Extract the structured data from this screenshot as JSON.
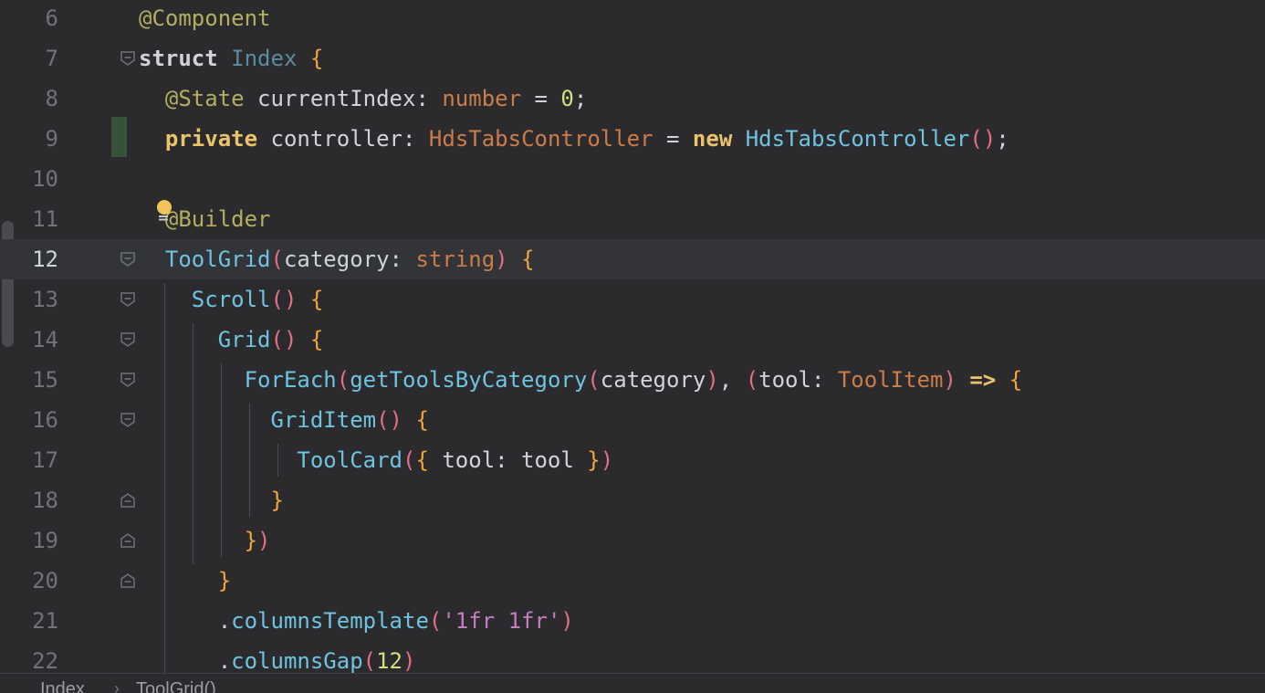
{
  "editor": {
    "lines": [
      {
        "number": "6",
        "tokens": [
          {
            "t": "@Component",
            "c": "ann"
          }
        ]
      },
      {
        "number": "7",
        "tokens": [
          {
            "t": "struct ",
            "c": "kw"
          },
          {
            "t": "Index",
            "c": "cls"
          },
          {
            "t": " ",
            "c": "pl"
          },
          {
            "t": "{",
            "c": "br1"
          }
        ]
      },
      {
        "number": "8",
        "tokens": [
          {
            "t": "  ",
            "c": "pl"
          },
          {
            "t": "@State",
            "c": "ann"
          },
          {
            "t": " currentIndex",
            "c": "pl"
          },
          {
            "t": ": ",
            "c": "pl"
          },
          {
            "t": "number",
            "c": "typ"
          },
          {
            "t": " = ",
            "c": "pl"
          },
          {
            "t": "0",
            "c": "numg"
          },
          {
            "t": ";",
            "c": "pl"
          }
        ]
      },
      {
        "number": "9",
        "tokens": [
          {
            "t": "  ",
            "c": "pl"
          },
          {
            "t": "private",
            "c": "kw2"
          },
          {
            "t": " controller",
            "c": "pl"
          },
          {
            "t": ": ",
            "c": "pl"
          },
          {
            "t": "HdsTabsController",
            "c": "typ"
          },
          {
            "t": " = ",
            "c": "pl"
          },
          {
            "t": "new",
            "c": "kw2"
          },
          {
            "t": " ",
            "c": "pl"
          },
          {
            "t": "HdsTabsController",
            "c": "mth"
          },
          {
            "t": "()",
            "c": "br2"
          },
          {
            "t": ";",
            "c": "pl"
          }
        ]
      },
      {
        "number": "10",
        "tokens": []
      },
      {
        "number": "11",
        "tokens": [
          {
            "t": "  ",
            "c": "pl"
          },
          {
            "t": "@Builder",
            "c": "ann"
          }
        ]
      },
      {
        "number": "12",
        "tokens": [
          {
            "t": "  ",
            "c": "pl"
          },
          {
            "t": "ToolGrid",
            "c": "mth"
          },
          {
            "t": "(",
            "c": "br2"
          },
          {
            "t": "category",
            "c": "pl"
          },
          {
            "t": ": ",
            "c": "pl"
          },
          {
            "t": "string",
            "c": "typ"
          },
          {
            "t": ")",
            "c": "br2"
          },
          {
            "t": " ",
            "c": "pl"
          },
          {
            "t": "{",
            "c": "br1"
          }
        ]
      },
      {
        "number": "13",
        "tokens": [
          {
            "t": "    ",
            "c": "pl"
          },
          {
            "t": "Scroll",
            "c": "mth"
          },
          {
            "t": "()",
            "c": "br2"
          },
          {
            "t": " ",
            "c": "pl"
          },
          {
            "t": "{",
            "c": "br1"
          }
        ]
      },
      {
        "number": "14",
        "tokens": [
          {
            "t": "      ",
            "c": "pl"
          },
          {
            "t": "Grid",
            "c": "mth"
          },
          {
            "t": "()",
            "c": "br2"
          },
          {
            "t": " ",
            "c": "pl"
          },
          {
            "t": "{",
            "c": "br1"
          }
        ]
      },
      {
        "number": "15",
        "tokens": [
          {
            "t": "        ",
            "c": "pl"
          },
          {
            "t": "ForEach",
            "c": "mth"
          },
          {
            "t": "(",
            "c": "br2"
          },
          {
            "t": "getToolsByCategory",
            "c": "mth"
          },
          {
            "t": "(",
            "c": "br2"
          },
          {
            "t": "category",
            "c": "pl"
          },
          {
            "t": ")",
            "c": "br2"
          },
          {
            "t": ", ",
            "c": "pl"
          },
          {
            "t": "(",
            "c": "br2"
          },
          {
            "t": "tool",
            "c": "pl"
          },
          {
            "t": ": ",
            "c": "pl"
          },
          {
            "t": "ToolItem",
            "c": "typ"
          },
          {
            "t": ")",
            "c": "br2"
          },
          {
            "t": " => ",
            "c": "kw2"
          },
          {
            "t": "{",
            "c": "br1"
          }
        ]
      },
      {
        "number": "16",
        "tokens": [
          {
            "t": "          ",
            "c": "pl"
          },
          {
            "t": "GridItem",
            "c": "mth"
          },
          {
            "t": "()",
            "c": "br2"
          },
          {
            "t": " ",
            "c": "pl"
          },
          {
            "t": "{",
            "c": "br1"
          }
        ]
      },
      {
        "number": "17",
        "tokens": [
          {
            "t": "            ",
            "c": "pl"
          },
          {
            "t": "ToolCard",
            "c": "mth"
          },
          {
            "t": "(",
            "c": "br2"
          },
          {
            "t": "{",
            "c": "br1"
          },
          {
            "t": " tool: tool ",
            "c": "pl"
          },
          {
            "t": "}",
            "c": "br1"
          },
          {
            "t": ")",
            "c": "br2"
          }
        ]
      },
      {
        "number": "18",
        "tokens": [
          {
            "t": "          ",
            "c": "pl"
          },
          {
            "t": "}",
            "c": "br1"
          }
        ]
      },
      {
        "number": "19",
        "tokens": [
          {
            "t": "        ",
            "c": "pl"
          },
          {
            "t": "}",
            "c": "br1"
          },
          {
            "t": ")",
            "c": "br2"
          }
        ]
      },
      {
        "number": "20",
        "tokens": [
          {
            "t": "      ",
            "c": "pl"
          },
          {
            "t": "}",
            "c": "br1"
          }
        ]
      },
      {
        "number": "21",
        "tokens": [
          {
            "t": "      .",
            "c": "pl"
          },
          {
            "t": "columnsTemplate",
            "c": "mth"
          },
          {
            "t": "(",
            "c": "br2"
          },
          {
            "t": "'1fr 1fr'",
            "c": "str"
          },
          {
            "t": ")",
            "c": "br2"
          }
        ]
      },
      {
        "number": "22",
        "tokens": [
          {
            "t": "      .",
            "c": "pl"
          },
          {
            "t": "columnsGap",
            "c": "mth"
          },
          {
            "t": "(",
            "c": "br2"
          },
          {
            "t": "12",
            "c": "numg"
          },
          {
            "t": ")",
            "c": "br2"
          }
        ]
      }
    ],
    "current_line": "12",
    "fold_open_lines": [
      "7",
      "12",
      "13",
      "14",
      "15",
      "16"
    ],
    "fold_close_lines": [
      "18",
      "19",
      "20"
    ],
    "changed_lines": [
      "9"
    ],
    "intention_bulb_line": "11"
  },
  "breadcrumb": {
    "items": [
      "Index",
      "ToolGrid()"
    ],
    "separator": "›"
  },
  "icons": {
    "fold-open": "fold-open-icon",
    "fold-close": "fold-close-icon",
    "bulb": "lightbulb-icon"
  }
}
